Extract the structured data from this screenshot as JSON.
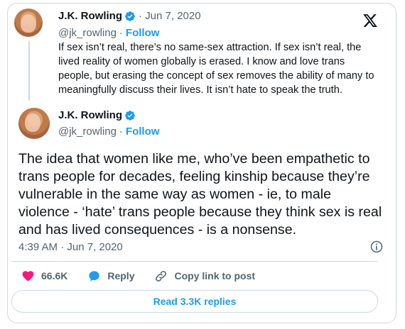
{
  "quoted_tweet": {
    "author_name": "J.K. Rowling",
    "date": "· Jun 7, 2020",
    "handle": "@jk_rowling",
    "separator": "·",
    "follow_label": "Follow",
    "text": "If sex isn’t real, there’s no same-sex attraction. If sex isn’t real, the lived reality of women globally is erased. I know and love trans people, but erasing the concept of sex removes the ability of many to meaningfully discuss their lives. It isn’t hate to speak the truth."
  },
  "main_tweet": {
    "author_name": "J.K. Rowling",
    "handle": "@jk_rowling",
    "separator": "·",
    "follow_label": "Follow",
    "text": "The idea that women like me, who’ve been empathetic to trans people for decades, feeling kinship because they’re vulnerable in the same way as women - ie, to male violence - ‘hate’ trans people because they think sex is real and has lived consequences - is a nonsense.",
    "timestamp": "4:39 AM · Jun 7, 2020"
  },
  "actions": {
    "likes": "66.6K",
    "reply_label": "Reply",
    "copy_link_label": "Copy link to post"
  },
  "read_replies_label": "Read 3.3K replies",
  "colors": {
    "accent": "#1d9bf0",
    "like": "#f91880",
    "text": "#0f1419",
    "muted": "#536471",
    "border": "#cfd9de"
  },
  "icons": [
    "verified-badge-icon",
    "x-logo-icon",
    "info-icon",
    "heart-icon",
    "reply-bubble-icon",
    "link-icon"
  ]
}
